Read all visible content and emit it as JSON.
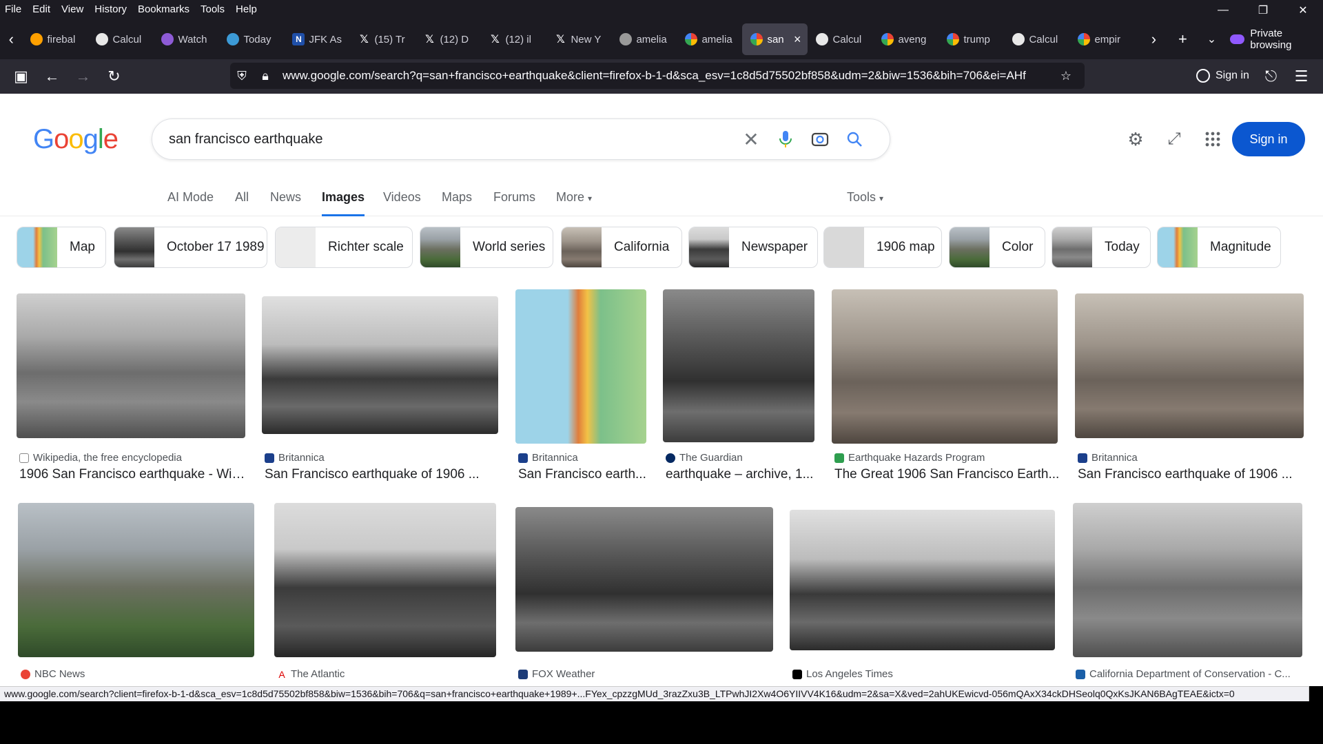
{
  "menubar": {
    "items": [
      "File",
      "Edit",
      "View",
      "History",
      "Bookmarks",
      "Tools",
      "Help"
    ]
  },
  "tabs": [
    {
      "label": "firebal",
      "icon": "firebase-icon",
      "color": "#ffa000"
    },
    {
      "label": "Calcul",
      "icon": "calculator-icon",
      "color": "#e8e8e8"
    },
    {
      "label": "Watch",
      "icon": "video-icon",
      "color": "#8e5bd6"
    },
    {
      "label": "Today",
      "icon": "globe-icon",
      "color": "#3c9ad6"
    },
    {
      "label": "JFK As",
      "icon": "n-icon",
      "color": "#1f4fa8"
    },
    {
      "label": "(15) Tr",
      "icon": "x-icon",
      "color": "#000000"
    },
    {
      "label": "(12) D",
      "icon": "x-icon",
      "color": "#000000"
    },
    {
      "label": "(12) il",
      "icon": "x-icon",
      "color": "#000000"
    },
    {
      "label": "New Y",
      "icon": "x-icon",
      "color": "#000000"
    },
    {
      "label": "amelia",
      "icon": "image-icon",
      "color": "#999999"
    },
    {
      "label": "amelia",
      "icon": "google-icon",
      "color": "#ffffff"
    },
    {
      "label": "san",
      "icon": "google-icon",
      "color": "#ffffff",
      "active": true
    },
    {
      "label": "Calcul",
      "icon": "calculator-icon",
      "color": "#e8e8e8"
    },
    {
      "label": "aveng",
      "icon": "google-icon",
      "color": "#ffffff"
    },
    {
      "label": "trump",
      "icon": "google-icon",
      "color": "#ffffff"
    },
    {
      "label": "Calcul",
      "icon": "calculator-icon",
      "color": "#e8e8e8"
    },
    {
      "label": "empir",
      "icon": "google-icon",
      "color": "#ffffff"
    }
  ],
  "private_label": "Private browsing",
  "url": "www.google.com/search?q=san+francisco+earthquake&client=firefox-b-1-d&sca_esv=1c8d5d75502bf858&udm=2&biw=1536&bih=706&ei=AHf",
  "browser_signin": "Sign in",
  "search": {
    "query": "san francisco earthquake",
    "signin": "Sign in"
  },
  "search_tabs": [
    "AI Mode",
    "All",
    "News",
    "Images",
    "Videos",
    "Maps",
    "Forums",
    "More",
    "Tools"
  ],
  "chips": [
    "Map",
    "October 17 1989",
    "Richter scale",
    "World series",
    "California",
    "Newspaper",
    "1906 map",
    "Color",
    "Today",
    "Magnitude"
  ],
  "results_row1": [
    {
      "source": "Wikipedia, the free encyclopedia",
      "title": "1906 San Francisco earthquake - Wik..."
    },
    {
      "source": "Britannica",
      "title": "San Francisco earthquake of 1906 ..."
    },
    {
      "source": "Britannica",
      "title": "San Francisco earth..."
    },
    {
      "source": "The Guardian",
      "title": "earthquake – archive, 1..."
    },
    {
      "source": "Earthquake Hazards Program",
      "title": "The Great 1906 San Francisco Earth..."
    },
    {
      "source": "Britannica",
      "title": "San Francisco earthquake of 1906 ..."
    }
  ],
  "results_row2": [
    {
      "source": "NBC News"
    },
    {
      "source": "The Atlantic"
    },
    {
      "source": "FOX Weather"
    },
    {
      "source": "Los Angeles Times"
    },
    {
      "source": "California Department of Conservation - C..."
    }
  ],
  "status_url": "www.google.com/search?client=firefox-b-1-d&sca_esv=1c8d5d75502bf858&biw=1536&bih=706&q=san+francisco+earthquake+1989+...FYex_cpzzgMUd_3razZxu3B_LTPwhJI2Xw4O6YIIVV4K16&udm=2&sa=X&ved=2ahUKEwicvd-056mQAxX34ckDHSeolq0QxKsJKAN6BAgTEAE&ictx=0"
}
